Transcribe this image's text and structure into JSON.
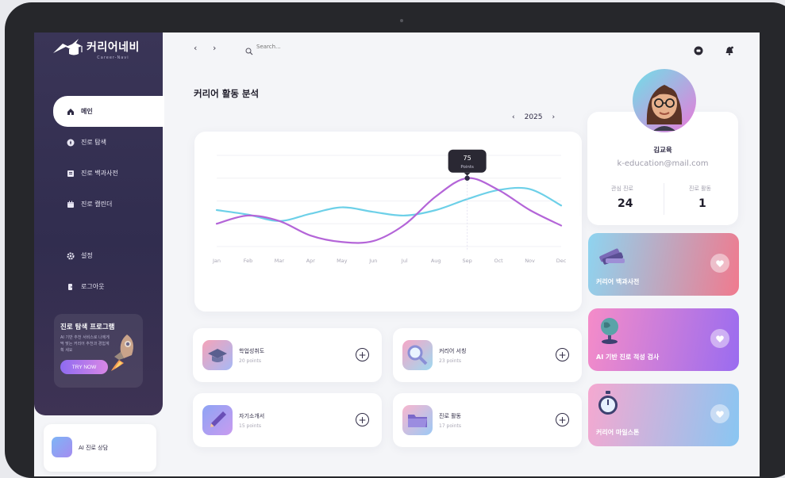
{
  "app": {
    "logo_title": "커리어네비",
    "logo_subtitle": "Career-Navi"
  },
  "sidebar": {
    "items": [
      {
        "label": "메인",
        "icon": "home-icon",
        "active": true
      },
      {
        "label": "진로 탐색",
        "icon": "compass-icon"
      },
      {
        "label": "진로 백과사전",
        "icon": "book-icon"
      },
      {
        "label": "진로 캘린더",
        "icon": "calendar-icon"
      },
      {
        "label": "설정",
        "icon": "gear-icon"
      },
      {
        "label": "로그아웃",
        "icon": "logout-icon"
      }
    ],
    "promo": {
      "title": "진로 탐색 프로그램",
      "description": "AI 기반 추천 서비스로 나에게 딱 맞는 커리어 추천과 경험계획 세요",
      "button": "TRY NOW"
    },
    "chat": {
      "title": "AI 진로 상담"
    }
  },
  "topbar": {
    "search_placeholder": "Search..."
  },
  "analysis": {
    "title": "커리어 활동 분석",
    "year": "2025",
    "tooltip_value": "75",
    "tooltip_unit": "Points"
  },
  "chart_data": {
    "type": "line",
    "categories": [
      "Jan",
      "Feb",
      "Mar",
      "Apr",
      "May",
      "Jun",
      "Jul",
      "Aug",
      "Sep",
      "Oct",
      "Nov",
      "Dec"
    ],
    "series": [
      {
        "color": "#6dd0e8",
        "values": [
          40,
          35,
          28,
          36,
          43,
          38,
          34,
          40,
          52,
          62,
          63,
          45
        ]
      },
      {
        "color": "#b465d8",
        "values": [
          25,
          34,
          28,
          12,
          5,
          6,
          24,
          55,
          75,
          62,
          40,
          23
        ]
      }
    ],
    "ylim": [
      0,
      100
    ],
    "grid": true,
    "highlight": {
      "category": "Sep",
      "value": 75
    }
  },
  "activities": [
    {
      "name": "학업성취도",
      "points": "20 points",
      "icon": "graduation-cap-icon",
      "color1": "#f5a3b8",
      "color2": "#a6b8f5"
    },
    {
      "name": "커리어 서칭",
      "points": "23 points",
      "icon": "magnifier-icon",
      "color1": "#f6a6c6",
      "color2": "#9fd9f0"
    },
    {
      "name": "자기소개서",
      "points": "15 points",
      "icon": "pen-icon",
      "color1": "#8ea4f4",
      "color2": "#c89bf0"
    },
    {
      "name": "진로 활동",
      "points": "17 points",
      "icon": "folder-icon",
      "color1": "#f8b6ce",
      "color2": "#9cc9f5"
    }
  ],
  "profile": {
    "name": "김교육",
    "email": "k-education@mail.com",
    "stats": [
      {
        "label": "관심 진로",
        "value": "24"
      },
      {
        "label": "진로 활동",
        "value": "1"
      }
    ]
  },
  "features": [
    {
      "label": "커리어 백과사전",
      "icon": "books-icon",
      "color1": "#8ed4f0",
      "color2": "#f07a8e"
    },
    {
      "label": "AI 기반 진로 적성 검사",
      "icon": "globe-icon",
      "color1": "#f58cc8",
      "color2": "#9a6cf0"
    },
    {
      "label": "커리어 마일스톤",
      "icon": "stopwatch-icon",
      "color1": "#f5a8d0",
      "color2": "#89c6f2"
    }
  ]
}
